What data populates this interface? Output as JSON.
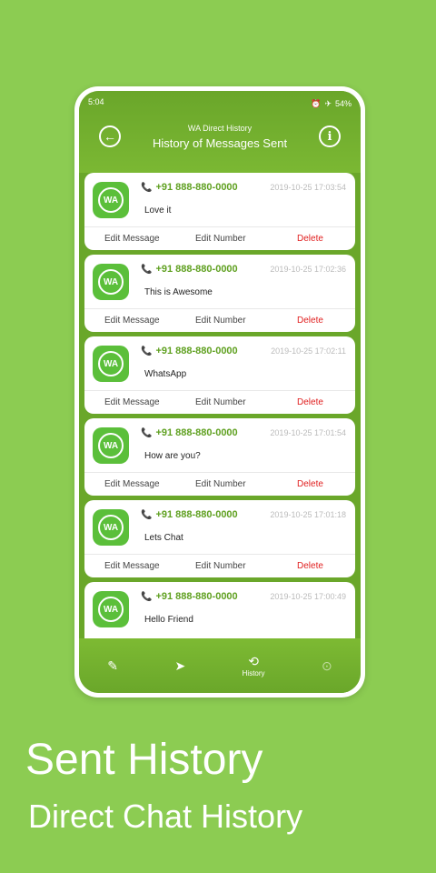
{
  "status": {
    "time": "5:04",
    "battery": "54%",
    "icons": [
      "alarm-icon",
      "airplane-icon"
    ]
  },
  "header": {
    "subtitle": "WA Direct History",
    "title": "History of Messages Sent",
    "back_icon": "arrow-left-icon",
    "info_icon": "info-icon"
  },
  "messages": [
    {
      "number": "+91 888-880-0000",
      "time": "2019-10-25 17:03:54",
      "text": "Love it"
    },
    {
      "number": "+91 888-880-0000",
      "time": "2019-10-25 17:02:36",
      "text": "This is Awesome"
    },
    {
      "number": "+91 888-880-0000",
      "time": "2019-10-25 17:02:11",
      "text": "WhatsApp"
    },
    {
      "number": "+91 888-880-0000",
      "time": "2019-10-25 17:01:54",
      "text": "How are you?"
    },
    {
      "number": "+91 888-880-0000",
      "time": "2019-10-25 17:01:18",
      "text": "Lets Chat"
    },
    {
      "number": "+91 888-880-0000",
      "time": "2019-10-25 17:00:49",
      "text": "Hello Friend"
    }
  ],
  "actions": {
    "edit_message": "Edit Message",
    "edit_number": "Edit Number",
    "delete": "Delete"
  },
  "logo_text": "WA",
  "bottom_nav": [
    {
      "icon": "pencil-icon",
      "label": ""
    },
    {
      "icon": "send-icon",
      "label": ""
    },
    {
      "icon": "history-icon",
      "label": "History"
    },
    {
      "icon": "settings-icon",
      "label": ""
    }
  ],
  "captions": {
    "big": "Sent History",
    "small": "Direct Chat History"
  },
  "colors": {
    "background": "#8ccc52",
    "header": "#6aa72a",
    "number": "#5fa020",
    "delete": "#e02020"
  }
}
